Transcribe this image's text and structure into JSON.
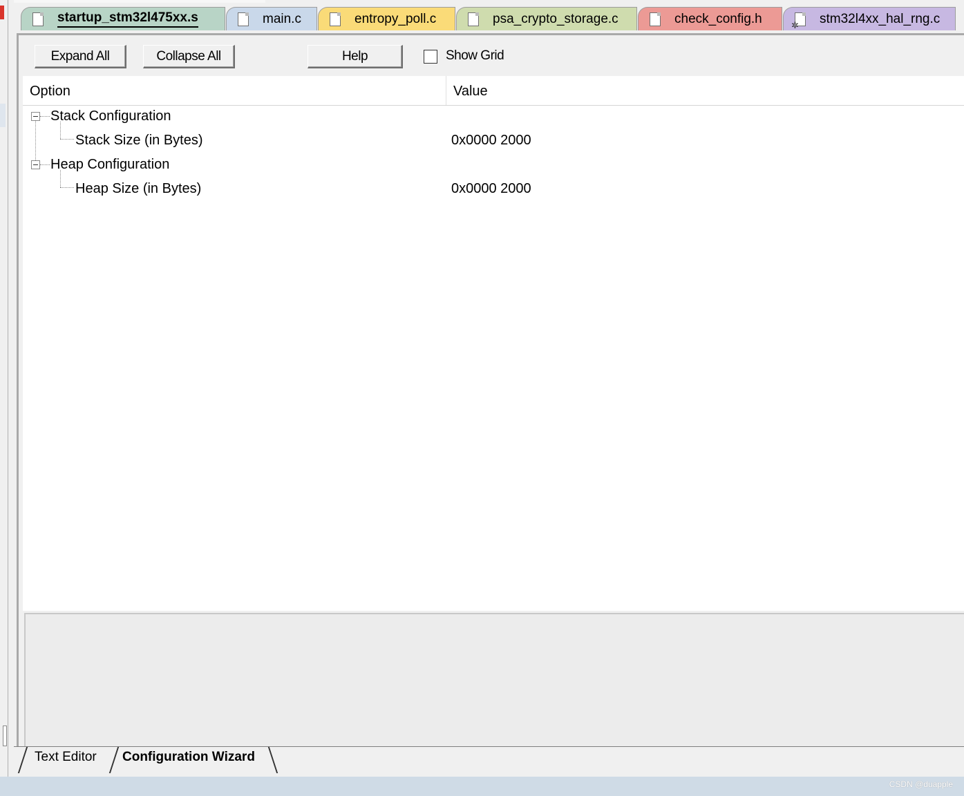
{
  "tabs": [
    {
      "label": "startup_stm32l475xx.s",
      "color": "#b8d4c6",
      "active": true,
      "icon": "file-icon"
    },
    {
      "label": "main.c",
      "color": "#c9d8ea",
      "active": false,
      "icon": "file-icon"
    },
    {
      "label": "entropy_poll.c",
      "color": "#fadb78",
      "active": false,
      "icon": "file-icon"
    },
    {
      "label": "psa_crypto_storage.c",
      "color": "#cfdcae",
      "active": false,
      "icon": "file-icon"
    },
    {
      "label": "check_config.h",
      "color": "#ec9a95",
      "active": false,
      "icon": "file-icon"
    },
    {
      "label": "stm32l4xx_hal_rng.c",
      "color": "#c7b8e2",
      "active": false,
      "icon": "file-gear-icon"
    }
  ],
  "toolbar": {
    "expand_all": "Expand All",
    "collapse_all": "Collapse All",
    "help": "Help",
    "show_grid": "Show Grid",
    "show_grid_checked": false
  },
  "grid": {
    "header_option": "Option",
    "header_value": "Value",
    "rows": [
      {
        "label": "Stack Configuration",
        "value": "",
        "level": 0,
        "expanded": true
      },
      {
        "label": "Stack Size (in Bytes)",
        "value": "0x0000 2000",
        "level": 1
      },
      {
        "label": "Heap Configuration",
        "value": "",
        "level": 0,
        "expanded": true
      },
      {
        "label": "Heap Size (in Bytes)",
        "value": "0x0000 2000",
        "level": 1
      }
    ]
  },
  "bottom_tabs": {
    "text_editor": "Text Editor",
    "config_wizard": "Configuration Wizard",
    "active": "config_wizard"
  },
  "watermark": "CSDN @duapple"
}
